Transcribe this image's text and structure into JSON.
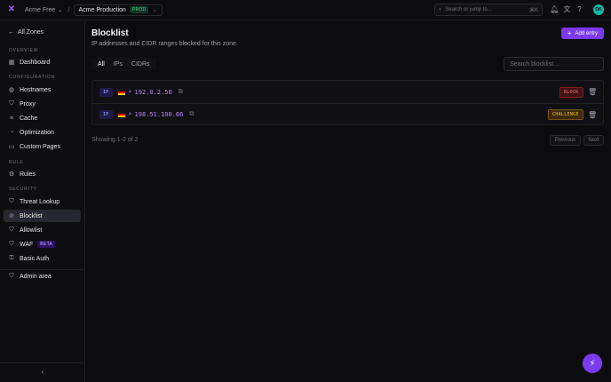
{
  "topbar": {
    "org_name": "Acme Free",
    "zone_name": "Acme Production",
    "zone_badge": "PROD",
    "search_placeholder": "Search or jump to...",
    "search_shortcut": "⌘K",
    "avatar_initials": "DK"
  },
  "sidebar": {
    "back_label": "All Zones",
    "sections": {
      "overview": "OVERVIEW",
      "configuration": "CONFIGURATION",
      "rule": "RULE",
      "security": "SECURITY"
    },
    "items": {
      "dashboard": "Dashboard",
      "hostnames": "Hostnames",
      "proxy": "Proxy",
      "cache": "Cache",
      "optimization": "Optimization",
      "custom_pages": "Custom Pages",
      "rules": "Rules",
      "threat_lookup": "Threat Lookup",
      "blocklist": "Blocklist",
      "allowlist": "Allowlist",
      "waf": "WAF",
      "waf_badge": "BETA",
      "basic_auth": "Basic Auth",
      "admin_area": "Admin area"
    },
    "active": "blocklist"
  },
  "main": {
    "title": "Blocklist",
    "subtitle": "IP addresses and CIDR ranges blocked for this zone.",
    "add_button": "Add entry",
    "tabs": [
      "All",
      "IPs",
      "CIDRs"
    ],
    "active_tab": "All",
    "search_placeholder": "Search blocklist...",
    "rows": [
      {
        "type": "IP",
        "ip": "192.0.2.50",
        "action": "BLOCK"
      },
      {
        "type": "IP",
        "ip": "198.51.100.66",
        "action": "CHALLENGE"
      }
    ],
    "showing": "Showing 1-2 of 2",
    "prev_label": "Previous",
    "next_label": "Next"
  },
  "colors": {
    "accent": "#7c3aed",
    "block": "#f87171",
    "challenge": "#fbbf24",
    "ip_text": "#c084fc"
  }
}
